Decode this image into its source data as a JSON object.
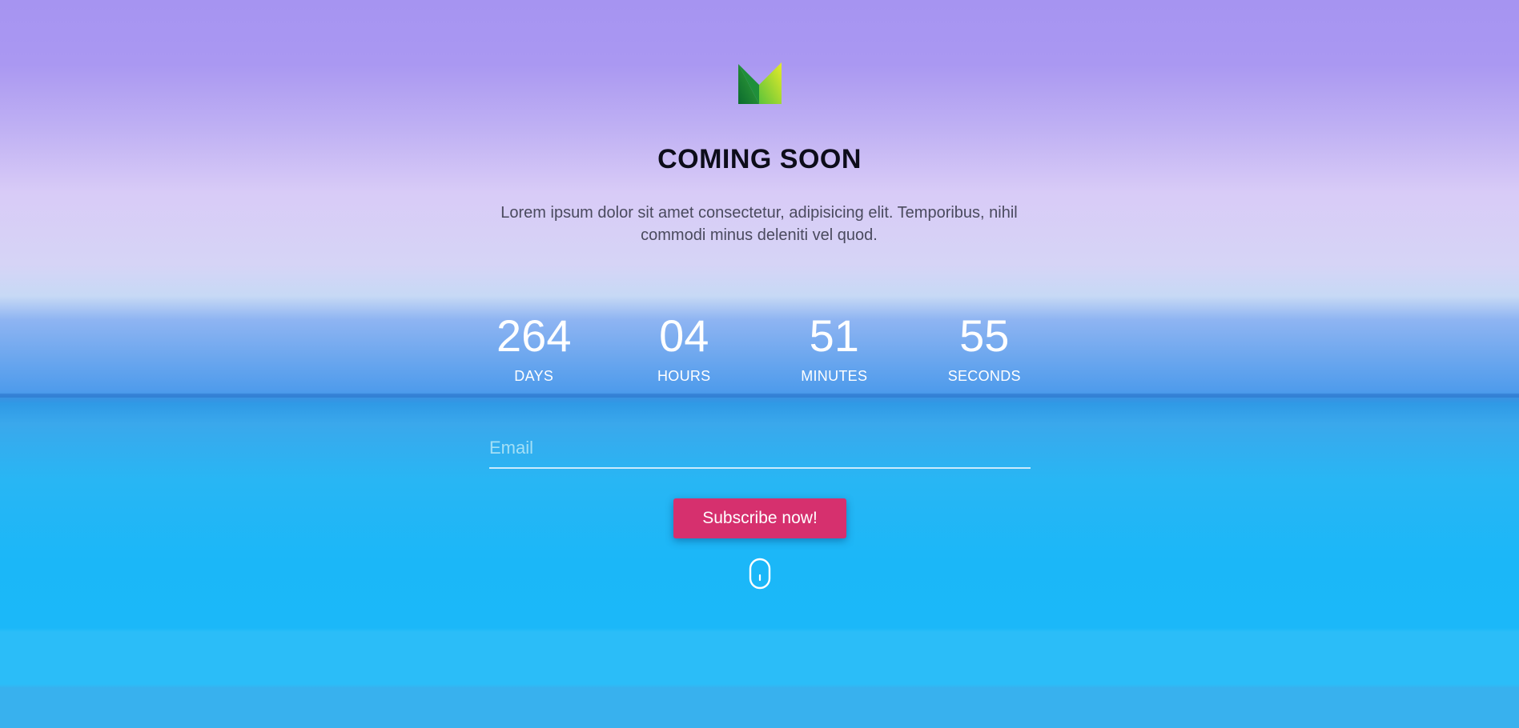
{
  "hero": {
    "logo_icon": "brand-m-logo-icon",
    "title": "COMING SOON",
    "description": "Lorem ipsum dolor sit amet consectetur, adipisicing elit. Temporibus, nihil commodi minus deleniti vel quod."
  },
  "countdown": [
    {
      "value": "264",
      "label": "DAYS"
    },
    {
      "value": "04",
      "label": "HOURS"
    },
    {
      "value": "51",
      "label": "MINUTES"
    },
    {
      "value": "55",
      "label": "SECONDS"
    }
  ],
  "subscribe": {
    "email_placeholder": "Email",
    "email_value": "",
    "button_label": "Subscribe now!"
  },
  "scroll_indicator_icon": "mouse-scroll-icon",
  "colors": {
    "button": "#d6306e",
    "countdown_text": "#ffffff",
    "title_text": "#0d0d1a"
  }
}
